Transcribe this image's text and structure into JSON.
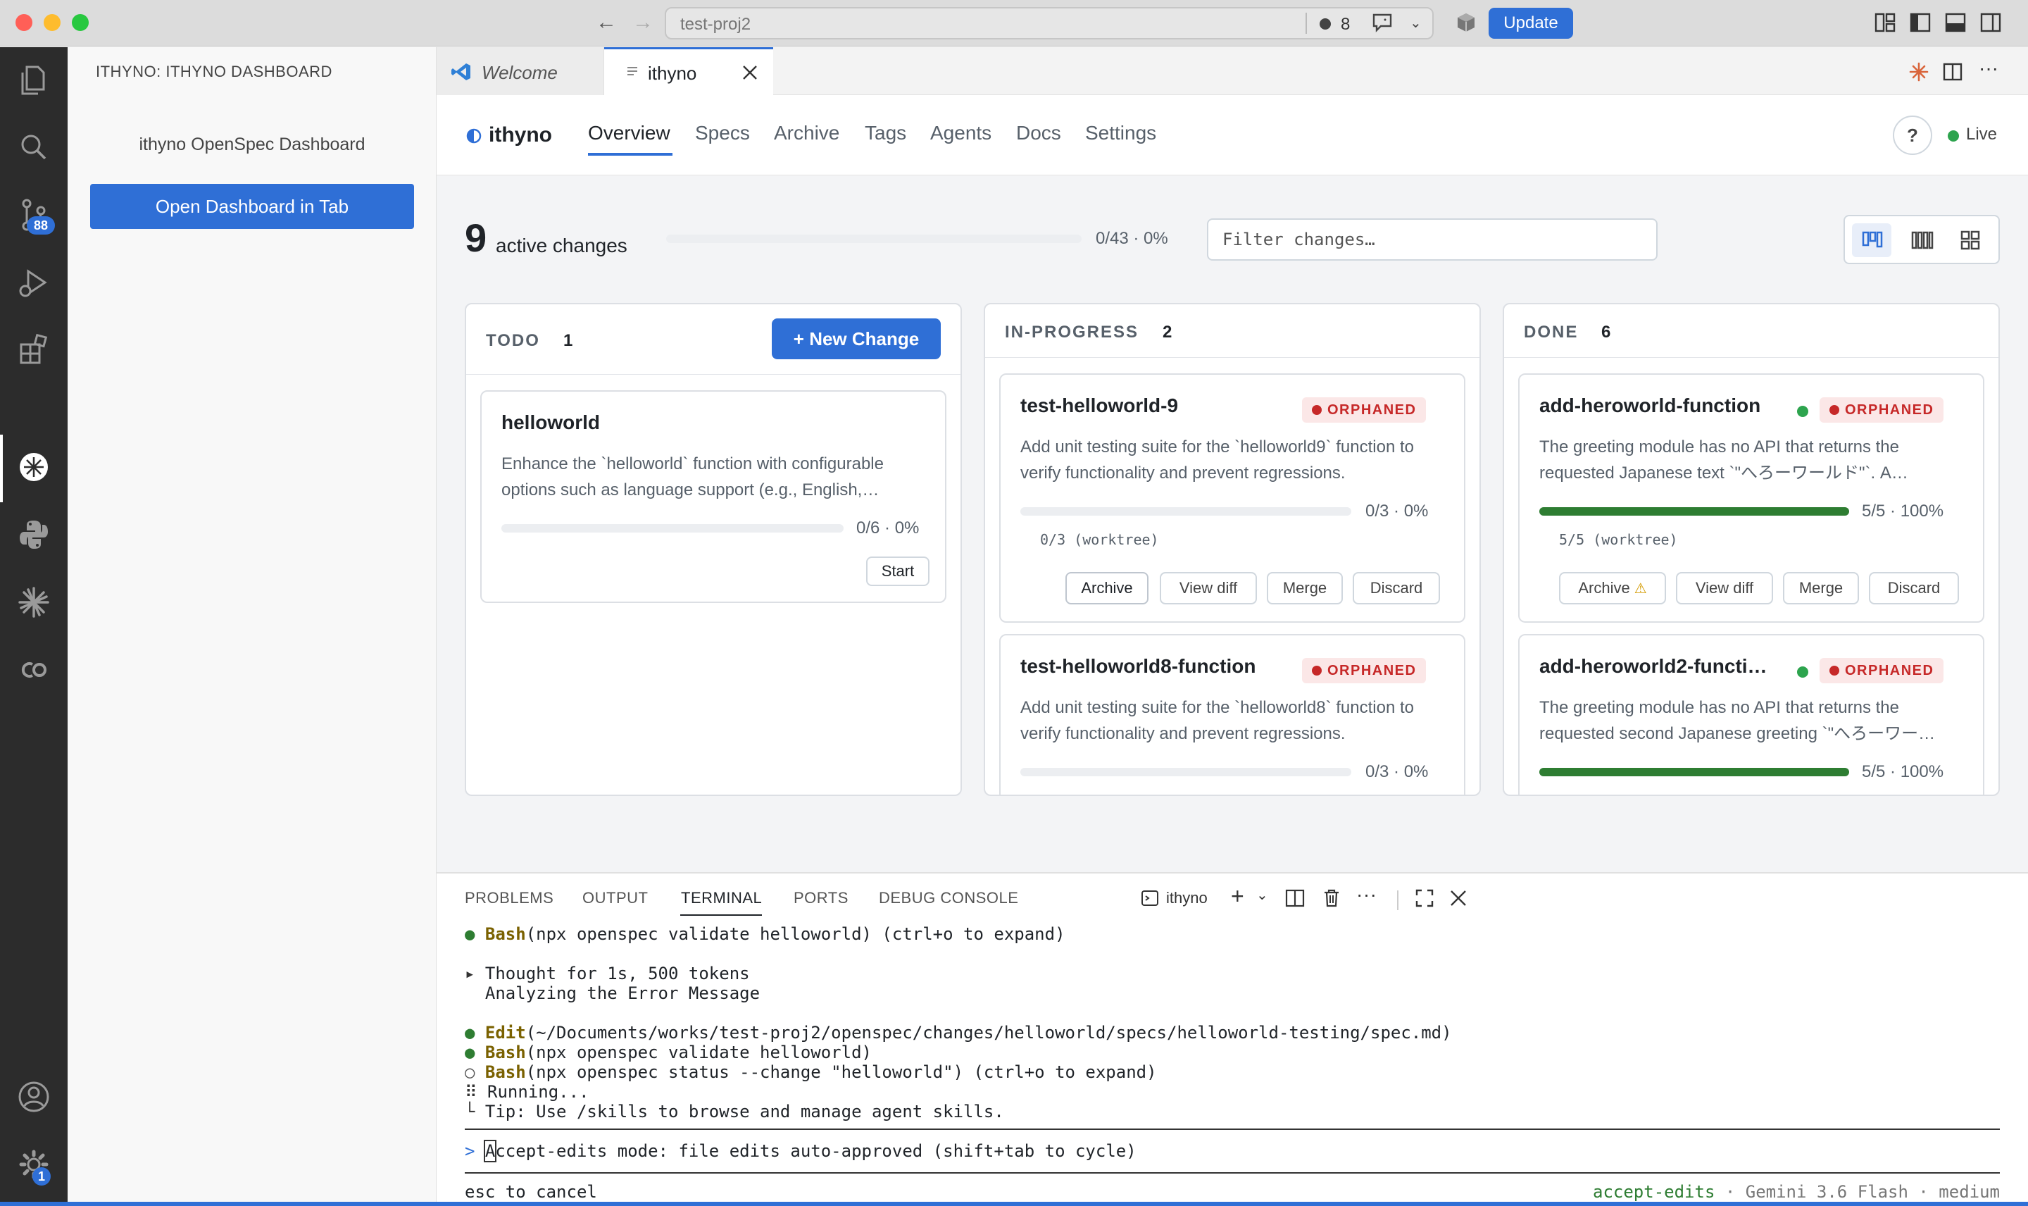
{
  "titlebar": {
    "address": "test-proj2",
    "count": "8",
    "update_label": "Update"
  },
  "activity": {
    "scm_badge": "88",
    "settings_badge": "1"
  },
  "sidebar": {
    "title": "ITHYNO: ITHYNO DASHBOARD",
    "subtitle": "ithyno OpenSpec Dashboard",
    "open_button": "Open Dashboard in Tab"
  },
  "tabs": [
    {
      "label": "Welcome"
    },
    {
      "label": "ithyno"
    }
  ],
  "dashboard": {
    "brand": "ithyno",
    "nav": [
      "Overview",
      "Specs",
      "Archive",
      "Tags",
      "Agents",
      "Docs",
      "Settings"
    ],
    "help": "?",
    "live": "Live",
    "active_count": "9",
    "active_label": "active changes",
    "overall_progress": {
      "text": "0/43 · 0%",
      "fraction": 0
    },
    "filter_placeholder": "Filter changes…"
  },
  "columns": [
    {
      "title": "TODO",
      "count": "1",
      "new_button": "+ New Change",
      "cards": [
        {
          "title": "helloworld",
          "description": "Enhance the `helloworld` function with configurable options such as language support (e.g., English,…",
          "progress_text": "0/6 · 0%",
          "progress": 0,
          "start": "Start"
        }
      ]
    },
    {
      "title": "IN-PROGRESS",
      "count": "2",
      "cards": [
        {
          "title": "test-helloworld-9",
          "badge": "ORPHANED",
          "description": "Add unit testing suite for the `helloworld9` function to verify functionality and prevent regressions.",
          "progress_text": "0/3 · 0%",
          "progress": 0,
          "worktree": "0/3 (worktree)",
          "actions": [
            "Archive",
            "View diff",
            "Merge",
            "Discard"
          ]
        },
        {
          "title": "test-helloworld8-function",
          "badge": "ORPHANED",
          "description": "Add unit testing suite for the `helloworld8` function to verify functionality and prevent regressions.",
          "progress_text": "0/3 · 0%",
          "progress": 0
        }
      ]
    },
    {
      "title": "DONE",
      "count": "6",
      "cards": [
        {
          "title": "add-heroworld-function",
          "badge": "ORPHANED",
          "description": "The greeting module has no API that returns the requested Japanese text `\"へろーワールド\"`. A…",
          "progress_text": "5/5 · 100%",
          "progress": 1,
          "worktree": "5/5 (worktree)",
          "actions": [
            "Archive",
            "View diff",
            "Merge",
            "Discard"
          ]
        },
        {
          "title": "add-heroworld2-functi…",
          "badge": "ORPHANED",
          "description": "The greeting module has no API that returns the requested second Japanese greeting `\"へろーワー…",
          "progress_text": "5/5 · 100%",
          "progress": 1
        }
      ]
    }
  ],
  "panel": {
    "tabs": [
      "PROBLEMS",
      "OUTPUT",
      "TERMINAL",
      "PORTS",
      "DEBUG CONSOLE"
    ],
    "terminal_name": "ithyno",
    "lines": {
      "l1_tool": "Bash",
      "l1_rest": "(npx openspec validate helloworld) (ctrl+o to expand)",
      "l2": "Thought for 1s, 500 tokens",
      "l3": "Analyzing the Error Message",
      "l4_tool": "Edit",
      "l4_rest": "(~/Documents/works/test-proj2/openspec/changes/helloworld/specs/helloworld-testing/spec.md)",
      "l5_tool": "Bash",
      "l5_rest": "(npx openspec validate helloworld)",
      "l6_tool": "Bash",
      "l6_rest": "(npx openspec status --change \"helloworld\") (ctrl+o to expand)",
      "l7": "Running...",
      "l8": "Tip: Use /skills to browse and manage agent skills.",
      "prompt_char": "A",
      "prompt_rest": "ccept-edits mode: file edits auto-approved (shift+tab to cycle)",
      "footer_left": "esc to cancel",
      "footer_mode": "accept-edits",
      "footer_sep1": " · ",
      "footer_model": "Gemini 3.6 Flash",
      "footer_sep2": " · ",
      "footer_effort": "medium"
    }
  },
  "colors": {
    "accent": "#2f6fd6",
    "orphan": "#c62828",
    "progress_done": "#2e7d32",
    "live": "#2da44e"
  }
}
